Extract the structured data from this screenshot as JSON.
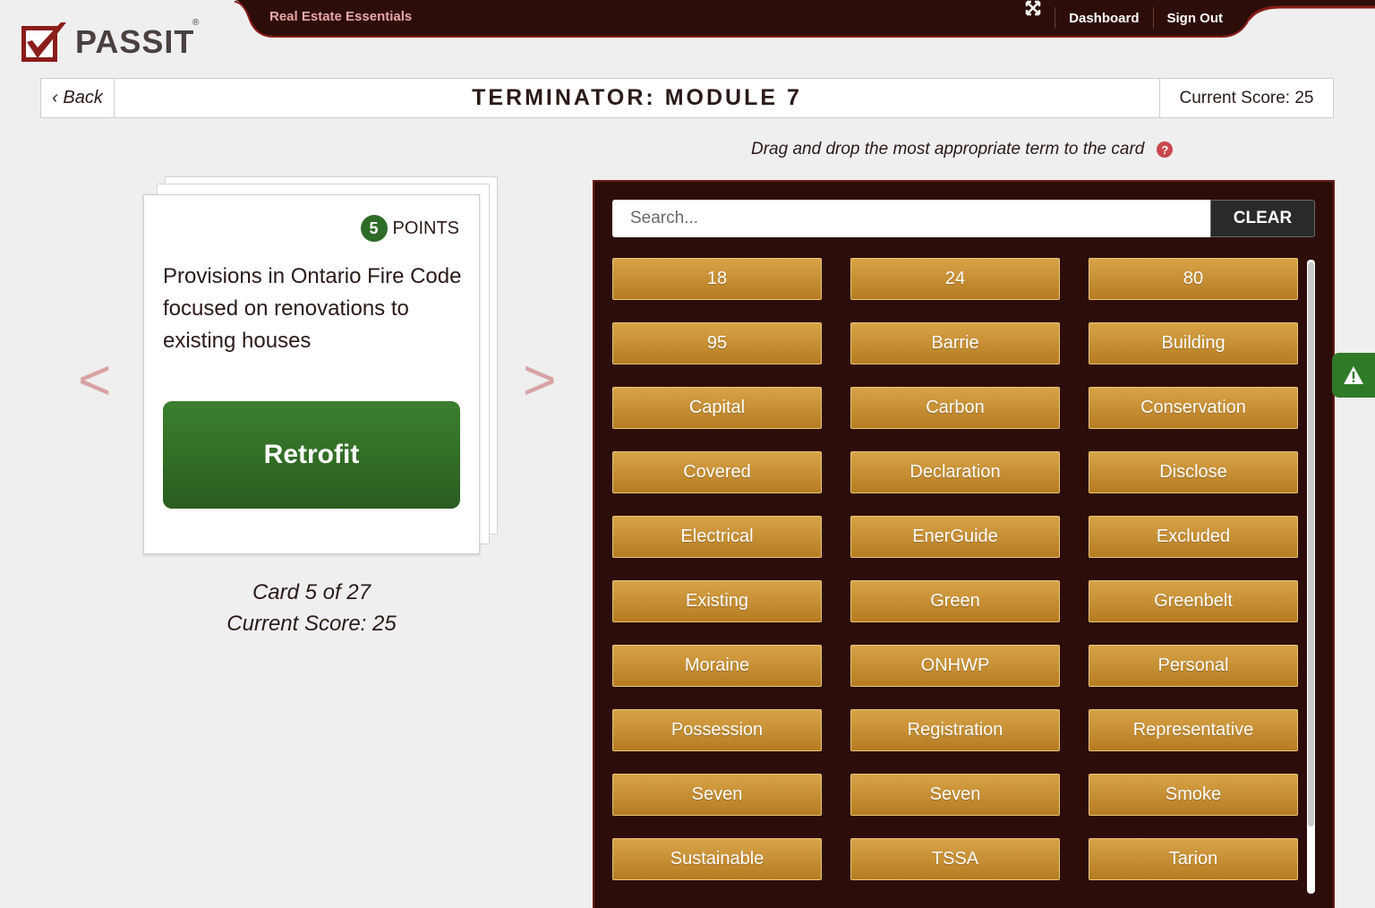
{
  "app": {
    "logo_text": "PASSIT",
    "logo_reg": "®",
    "course_title": "Real Estate Essentials"
  },
  "nav": {
    "fullscreen_icon": "fullscreen-icon",
    "dashboard": "Dashboard",
    "sign_out": "Sign Out"
  },
  "header": {
    "back_label": "‹ Back",
    "title": "TERMINATOR: MODULE 7",
    "score": "Current Score: 25"
  },
  "instruction": {
    "text": "Drag and drop the most appropriate term to the card",
    "help_icon": "?"
  },
  "card": {
    "points_value": "5",
    "points_label": "POINTS",
    "question": "Provisions in Ontario Fire Code focused on renovations to existing houses",
    "answer": "Retrofit",
    "prev_arrow": "<",
    "next_arrow": ">",
    "counter": "Card 5 of 27",
    "score": "Current Score: 25"
  },
  "terms_panel": {
    "search_placeholder": "Search...",
    "clear_label": "CLEAR",
    "terms": [
      "18",
      "24",
      "80",
      "95",
      "Barrie",
      "Building",
      "Capital",
      "Carbon",
      "Conservation",
      "Covered",
      "Declaration",
      "Disclose",
      "Electrical",
      "EnerGuide",
      "Excluded",
      "Existing",
      "Green",
      "Greenbelt",
      "Moraine",
      "ONHWP",
      "Personal",
      "Possession",
      "Registration",
      "Representative",
      "Seven",
      "Seven",
      "Smoke",
      "Sustainable",
      "TSSA",
      "Tarion"
    ]
  },
  "colors": {
    "brand_dark": "#2d0d09",
    "term_gold": "#c89035",
    "answer_green": "#2f6b28",
    "accent_red": "#c9474d"
  }
}
